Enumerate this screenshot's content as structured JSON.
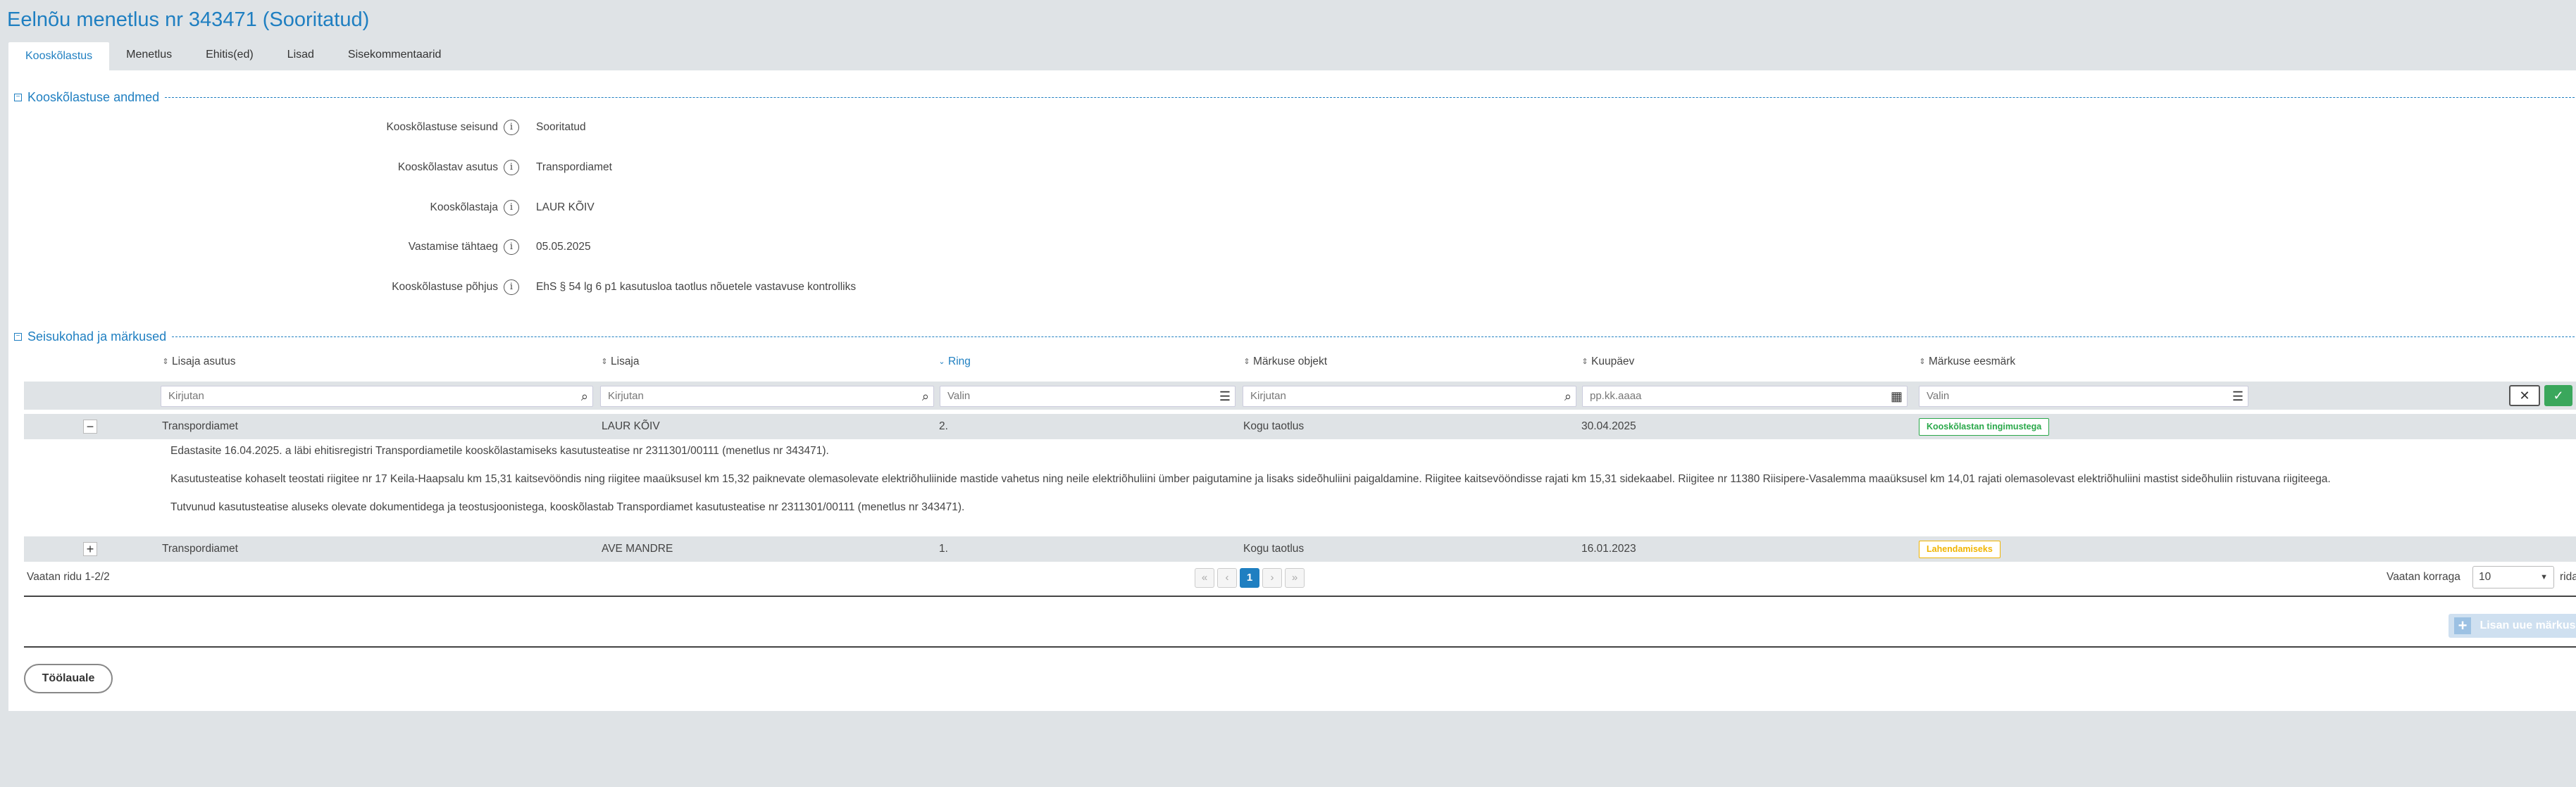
{
  "page": {
    "title": "Eelnõu menetlus nr 343471 (Sooritatud)"
  },
  "tabs": [
    {
      "label": "Kooskõlastus",
      "active": true
    },
    {
      "label": "Menetlus"
    },
    {
      "label": "Ehitis(ed)"
    },
    {
      "label": "Lisad"
    },
    {
      "label": "Sisekommentaarid"
    }
  ],
  "approval_section": {
    "title": "Kooskõlastuse andmed",
    "toggle": "−",
    "fields": [
      {
        "label": "Kooskõlastuse seisund",
        "value": "Sooritatud"
      },
      {
        "label": "Kooskõlastav asutus",
        "value": "Transpordiamet"
      },
      {
        "label": "Kooskõlastaja",
        "value": "LAUR KÕIV"
      },
      {
        "label": "Vastamise tähtaeg",
        "value": "05.05.2025"
      },
      {
        "label": "Kooskõlastuse põhjus",
        "value": "EhS § 54 lg 6 p1 kasutusloa taotlus nõuetele vastavuse kontrolliks"
      }
    ],
    "info_glyph": "i"
  },
  "remarks_section": {
    "title": "Seisukohad ja märkused",
    "toggle": "−",
    "columns": [
      {
        "label": "Lisaja asutus",
        "sort_icon": "⇕"
      },
      {
        "label": "Lisaja",
        "sort_icon": "⇕"
      },
      {
        "label": "Ring",
        "sort_icon": "⌄"
      },
      {
        "label": "Märkuse objekt",
        "sort_icon": "⇕"
      },
      {
        "label": "Kuupäev",
        "sort_icon": "⇕"
      },
      {
        "label": "Märkuse eesmärk",
        "sort_icon": "⇕"
      }
    ],
    "filters": [
      {
        "placeholder": "Kirjutan",
        "icon": "⌕"
      },
      {
        "placeholder": "Kirjutan",
        "icon": "⌕"
      },
      {
        "placeholder": "Valin",
        "icon": "☰"
      },
      {
        "placeholder": "Kirjutan",
        "icon": "⌕"
      },
      {
        "placeholder": "pp.kk.aaaa",
        "icon": "▦"
      },
      {
        "placeholder": "Valin",
        "icon": "☰"
      }
    ],
    "clear_icon": "✕",
    "apply_icon": "✓",
    "rows": [
      {
        "expander": "−",
        "institution": "Transpordiamet",
        "author": "LAUR KÕIV",
        "round": "2.",
        "object": "Kogu taotlus",
        "date": "30.04.2025",
        "purpose": "Kooskõlastan tingimustega",
        "purpose_color": "#2aa84a",
        "details": [
          "Edastasite 16.04.2025. a läbi ehitisregistri Transpordiametile kooskõlastamiseks kasutusteatise nr 2311301/00111 (menetlus nr 343471).",
          "Kasutusteatise kohaselt teostati riigitee nr 17 Keila-Haapsalu km 15,31 kaitsevööndis ning riigitee maaüksusel km 15,32 paiknevate olemasolevate elektriõhuliinide mastide vahetus ning neile elektriõhuliini ümber paigutamine ja lisaks sideõhuliini paigaldamine. Riigitee kaitsevööndisse rajati km 15,31 sidekaabel. Riigitee nr 11380 Riisipere-Vasalemma maaüksusel km 14,01 rajati olemasolevast elektriõhuliini mastist sideõhuliin ristuvana riigiteega.",
          "Tutvunud kasutusteatise aluseks olevate dokumentidega ja teostusjoonistega, kooskõlastab Transpordiamet kasutusteatise nr 2311301/00111 (menetlus nr 343471)."
        ]
      },
      {
        "expander": "+",
        "institution": "Transpordiamet",
        "author": "AVE MANDRE",
        "round": "1.",
        "object": "Kogu taotlus",
        "date": "16.01.2023",
        "purpose": "Lahendamiseks",
        "purpose_color": "#f0b400"
      }
    ],
    "row_count_text": "Vaatan ridu 1-2/2",
    "pagination": {
      "first": "«",
      "prev": "‹",
      "current": "1",
      "next": "›",
      "last": "»"
    },
    "page_size_label": "Vaatan korraga",
    "page_size_value": "10",
    "page_size_suffix": "rida",
    "add_remark_label": "Lisan uue märkuse",
    "add_icon": "+"
  },
  "footer": {
    "back_button": "Töölauale"
  }
}
